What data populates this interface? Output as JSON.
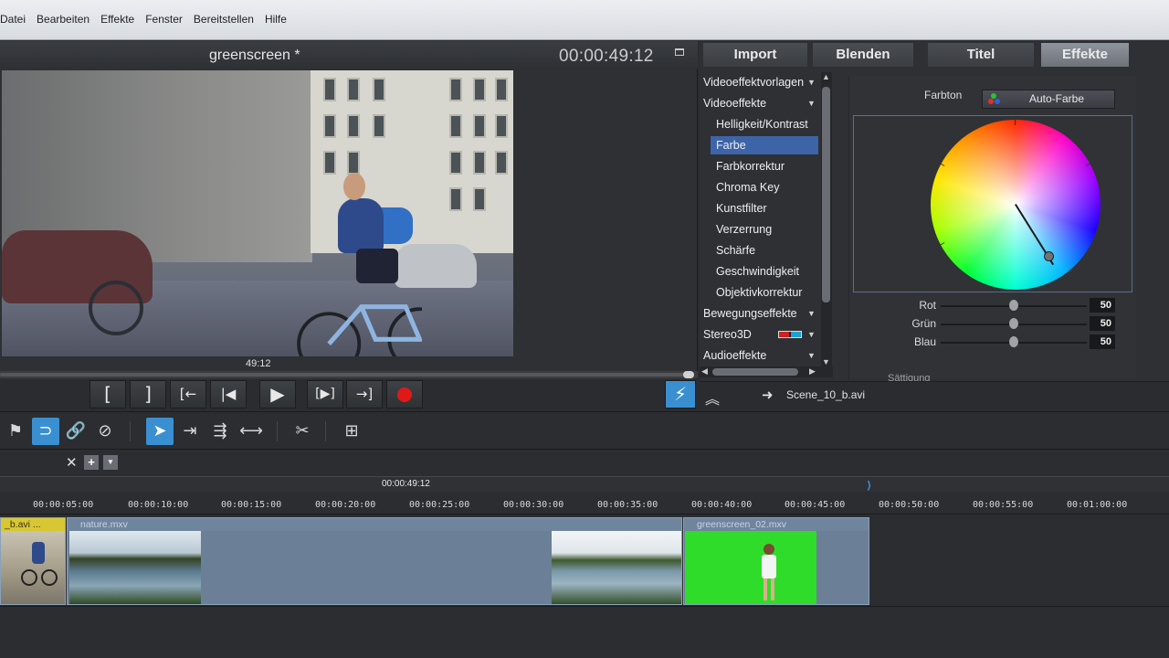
{
  "menu": [
    "Datei",
    "Bearbeiten",
    "Effekte",
    "Fenster",
    "Bereitstellen",
    "Hilfe"
  ],
  "monitor": {
    "title": "greenscreen *",
    "timecode": "00:00:49:12",
    "frame_label": "49:12"
  },
  "transport": {
    "buttons": [
      "[",
      "]",
      "[←",
      "|◀",
      "▶",
      "[▶]",
      "→]"
    ]
  },
  "tabs": [
    "Import",
    "Blenden",
    "Titel",
    "Effekte"
  ],
  "active_tab": "Effekte",
  "tree": {
    "groups": [
      {
        "label": "Videoeffektvorlagen"
      },
      {
        "label": "Videoeffekte"
      },
      {
        "label": "Bewegungseffekte"
      },
      {
        "label": "Stereo3D"
      },
      {
        "label": "Audioeffekte"
      }
    ],
    "videoeffekte_items": [
      "Helligkeit/Kontrast",
      "Farbe",
      "Farbkorrektur",
      "Chroma Key",
      "Kunstfilter",
      "Verzerrung",
      "Schärfe",
      "Geschwindigkeit",
      "Objektivkorrektur"
    ],
    "selected": "Farbe"
  },
  "effect": {
    "farbton_label": "Farbton",
    "auto_button": "Auto-Farbe",
    "sliders": [
      {
        "label": "Rot",
        "value": "50"
      },
      {
        "label": "Grün",
        "value": "50"
      },
      {
        "label": "Blau",
        "value": "50"
      }
    ],
    "partial_label": "Sättigung"
  },
  "status": {
    "file": "Scene_10_b.avi"
  },
  "timeline": {
    "playhead_tc": "00:00:49:12",
    "ruler": [
      "00:00:05:00",
      "00:00:10:00",
      "00:00:15:00",
      "00:00:20:00",
      "00:00:25:00",
      "00:00:30:00",
      "00:00:35:00",
      "00:00:40:00",
      "00:00:45:00",
      "00:00:50:00",
      "00:00:55:00",
      "00:01:00:00"
    ],
    "clips": [
      {
        "name": "_b.avi ..."
      },
      {
        "name": "nature.mxv"
      },
      {
        "name": "greenscreen_02.mxv"
      }
    ]
  },
  "colors": {
    "accent": "#3a8fd0",
    "selection": "#3e64a8",
    "record": "#e01818",
    "greenscreen": "#2fdc2a",
    "clip_yellow": "#d8c733"
  }
}
